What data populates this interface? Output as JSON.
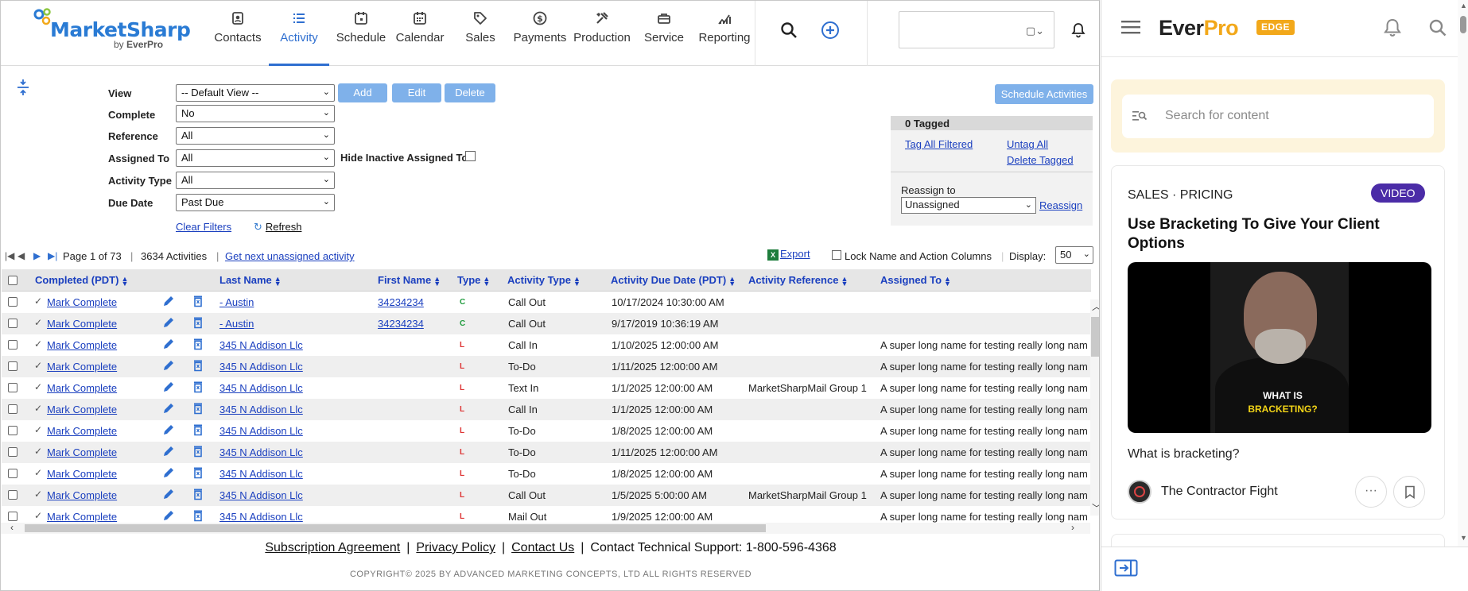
{
  "nav": {
    "brand": "MarketSharp",
    "by": "by",
    "by_brand": "EverPro",
    "items": [
      {
        "label": "Contacts"
      },
      {
        "label": "Activity"
      },
      {
        "label": "Schedule"
      },
      {
        "label": "Calendar"
      },
      {
        "label": "Sales"
      },
      {
        "label": "Payments"
      },
      {
        "label": "Production"
      },
      {
        "label": "Service"
      },
      {
        "label": "Reporting"
      }
    ],
    "active": "Activity"
  },
  "filters": {
    "view_label": "View",
    "view_value": "-- Default View --",
    "complete_label": "Complete",
    "complete_value": "No",
    "reference_label": "Reference",
    "reference_value": "All",
    "assigned_label": "Assigned To",
    "assigned_value": "All",
    "activity_type_label": "Activity Type",
    "activity_type_value": "All",
    "due_date_label": "Due Date",
    "due_date_value": "Past Due",
    "hide_inactive_label": "Hide Inactive Assigned To",
    "clear_filters": "Clear Filters",
    "refresh": "Refresh",
    "add": "Add",
    "edit": "Edit",
    "delete": "Delete"
  },
  "tagging": {
    "schedule_activities": "Schedule Activities",
    "tagged": "0 Tagged",
    "tag_all_filtered": "Tag All Filtered",
    "untag_all": "Untag All",
    "delete_tagged": "Delete Tagged",
    "reassign_to": "Reassign to",
    "reassign_value": "Unassigned",
    "reassign": "Reassign"
  },
  "pager": {
    "page_text": "Page 1  of 73",
    "activities": "3634 Activities",
    "get_next": "Get next unassigned activity",
    "export": "Export",
    "lock_label": "Lock Name and Action Columns",
    "display_label": "Display:",
    "display_value": "50"
  },
  "table": {
    "headers": {
      "completed": "Completed (PDT)",
      "last_name": "Last Name",
      "first_name": "First Name",
      "type": "Type",
      "activity_type": "Activity Type",
      "due_date": "Activity Due Date (PDT)",
      "reference": "Activity Reference",
      "assigned": "Assigned To"
    },
    "rows": [
      {
        "complete": "Mark Complete",
        "last": "- Austin",
        "first": "34234234",
        "type": "C",
        "activity": "Call Out",
        "due": "10/17/2024 10:30:00 AM",
        "ref": "",
        "assigned": ""
      },
      {
        "complete": "Mark Complete",
        "last": "- Austin",
        "first": "34234234",
        "type": "C",
        "activity": "Call Out",
        "due": "9/17/2019 10:36:19 AM",
        "ref": "",
        "assigned": ""
      },
      {
        "complete": "Mark Complete",
        "last": "345 N Addison Llc",
        "first": "",
        "type": "L",
        "activity": "Call In",
        "due": "1/10/2025 12:00:00 AM",
        "ref": "",
        "assigned": "A super long name for testing really long nam"
      },
      {
        "complete": "Mark Complete",
        "last": "345 N Addison Llc",
        "first": "",
        "type": "L",
        "activity": "To-Do",
        "due": "1/11/2025 12:00:00 AM",
        "ref": "",
        "assigned": "A super long name for testing really long nam"
      },
      {
        "complete": "Mark Complete",
        "last": "345 N Addison Llc",
        "first": "",
        "type": "L",
        "activity": "Text In",
        "due": "1/1/2025 12:00:00 AM",
        "ref": "MarketSharpMail Group 1",
        "assigned": "A super long name for testing really long nam"
      },
      {
        "complete": "Mark Complete",
        "last": "345 N Addison Llc",
        "first": "",
        "type": "L",
        "activity": "Call In",
        "due": "1/1/2025 12:00:00 AM",
        "ref": "",
        "assigned": "A super long name for testing really long nam"
      },
      {
        "complete": "Mark Complete",
        "last": "345 N Addison Llc",
        "first": "",
        "type": "L",
        "activity": "To-Do",
        "due": "1/8/2025 12:00:00 AM",
        "ref": "",
        "assigned": "A super long name for testing really long nam"
      },
      {
        "complete": "Mark Complete",
        "last": "345 N Addison Llc",
        "first": "",
        "type": "L",
        "activity": "To-Do",
        "due": "1/11/2025 12:00:00 AM",
        "ref": "",
        "assigned": "A super long name for testing really long nam"
      },
      {
        "complete": "Mark Complete",
        "last": "345 N Addison Llc",
        "first": "",
        "type": "L",
        "activity": "To-Do",
        "due": "1/8/2025 12:00:00 AM",
        "ref": "",
        "assigned": "A super long name for testing really long nam"
      },
      {
        "complete": "Mark Complete",
        "last": "345 N Addison Llc",
        "first": "",
        "type": "L",
        "activity": "Call Out",
        "due": "1/5/2025 5:00:00 AM",
        "ref": "MarketSharpMail Group 1",
        "assigned": "A super long name for testing really long nam"
      },
      {
        "complete": "Mark Complete",
        "last": "345 N Addison Llc",
        "first": "",
        "type": "L",
        "activity": "Mail Out",
        "due": "1/9/2025 12:00:00 AM",
        "ref": "",
        "assigned": "A super long name for testing really long nam"
      }
    ]
  },
  "footer": {
    "subscription": "Subscription Agreement",
    "privacy": "Privacy Policy",
    "contact": "Contact Us",
    "support": "Contact Technical Support: 1-800-596-4368",
    "copyright": "COPYRIGHT© 2025 BY ADVANCED MARKETING CONCEPTS, LTD ALL RIGHTS RESERVED"
  },
  "panel": {
    "brand_ever": "Ever",
    "brand_pro": "Pro",
    "edge": "EDGE",
    "search_placeholder": "Search for content",
    "card": {
      "category": "SALES · PRICING",
      "badge": "VIDEO",
      "title": "Use Bracketing To Give Your Client Options",
      "thumb_line1": "WHAT IS",
      "thumb_line2": "BRACKETING?",
      "description": "What is bracketing?",
      "author": "The Contractor Fight"
    }
  },
  "colors": {
    "accent": "#2f6fd0",
    "button_blue": "#7fb1ea",
    "link": "#1a3fbf",
    "everpro_orange": "#f2a81a",
    "video_purple": "#4b2ca7",
    "type_c": "#1e9b3c",
    "type_l": "#dd3333"
  }
}
